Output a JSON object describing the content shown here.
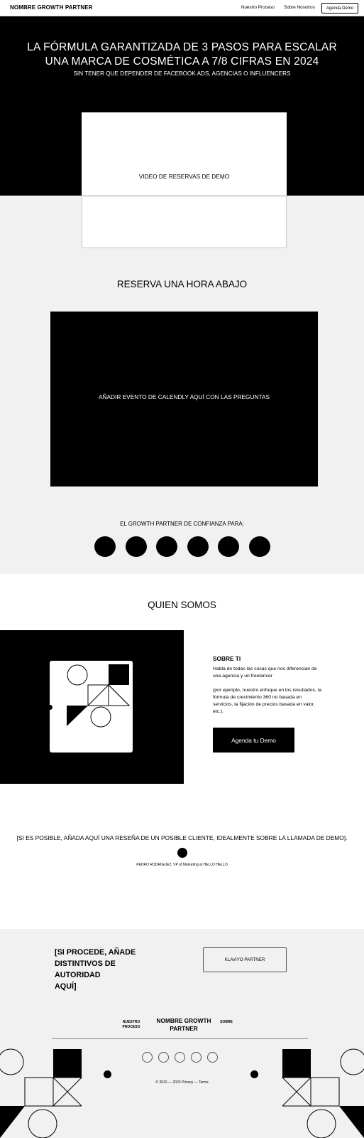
{
  "header": {
    "brand": "NOMBRE GROWTH PARTNER",
    "nav": [
      "Nuestro Proceso",
      "Sobre Nosotros"
    ],
    "demo_button": "Agenda Demo"
  },
  "hero": {
    "title_line1": "LA FÓRMULA GARANTIZADA DE 3 PASOS PARA ESCALAR",
    "title_line2": "UNA MARCA DE COSMÉTICA A 7/8 CIFRAS EN 2024",
    "subtitle": "SIN TENER QUE DEPENDER DE FACEBOOK ADS, AGENCIAS O INFLUENCERS",
    "video_label": "VIDEO DE RESERVAS DE DEMO"
  },
  "reserve": {
    "title": "RESERVA UNA HORA ABAJO",
    "calendly_label": "AÑADIR EVENTO DE CALENDLY  AQUÍ CON LAS PREGUNTAS"
  },
  "trust": {
    "title": "EL GROWTH PARTNER DE CONFIANZA PARA:",
    "logo_count": 6
  },
  "who": {
    "title": "QUIEN SOMOS",
    "about_title": "SOBRE TI",
    "about_p1": "Habla de todas las cosas que nos diferencian de una agencia y un freelancer",
    "about_p2": "(por ejemplo, nuestro enfoque en los resultados, la fórmula de crecimiento 360 no basada en servicios, la fijación de precios basada en valor, etc.).",
    "cta": "Agenda tu Demo"
  },
  "review": {
    "text": "[SI ES POSIBLE, AÑADA AQUÍ UNA RESEÑA DE UN POSIBLE CLIENTE, IDEALMENTE SOBRE LA LLAMADA DE DEMO].",
    "author": "PEDRO RODRIGUEZ, VP of Marketing at HELLO HELLO"
  },
  "authority": {
    "text_lines": [
      "[SI PROCEDE, AÑADE",
      "DISTINTIVOS DE",
      "AUTORIDAD",
      "AQUÍ]"
    ],
    "badge": "KLAVIYO PARTNER"
  },
  "footer": {
    "nav_left_line1": "NUESTRO",
    "nav_left_line2": "PROCESO",
    "brand_line1": "NOMBRE GROWTH",
    "brand_line2": "PARTNER",
    "nav_right": "SOBRE",
    "social_count": 5,
    "copyright": "© 2010 — 2023    Privacy — Terms"
  }
}
